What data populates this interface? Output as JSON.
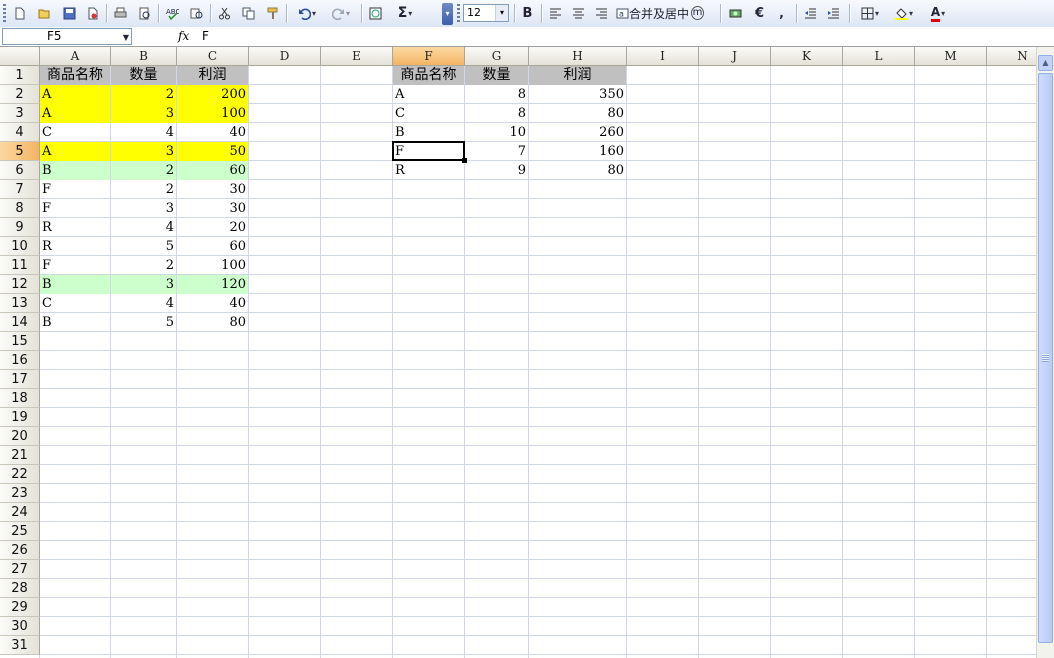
{
  "toolbar": {
    "font_size": "12",
    "merge_label": "合并及居中",
    "bold_label": "B",
    "sum_label": "Σ",
    "currency_label": "€",
    "comma_label": ",",
    "font_color_label": "A"
  },
  "formula_bar": {
    "name_box": "F5",
    "fx_label": "fx",
    "value": "F"
  },
  "sheet": {
    "columns": [
      "A",
      "B",
      "C",
      "D",
      "E",
      "F",
      "G",
      "H",
      "I",
      "J",
      "K",
      "L",
      "M",
      "N"
    ],
    "selected_column": "F",
    "rows": [
      "1",
      "2",
      "3",
      "4",
      "5",
      "6",
      "7",
      "8",
      "9",
      "10",
      "11",
      "12",
      "13",
      "14",
      "15",
      "16",
      "17",
      "18",
      "19",
      "20",
      "21",
      "22",
      "23",
      "24",
      "25",
      "26",
      "27",
      "28",
      "29",
      "30",
      "31"
    ],
    "selected_row": "5",
    "table1": {
      "headers": [
        "商品名称",
        "数量",
        "利润"
      ],
      "rows": [
        [
          "A",
          "2",
          "200"
        ],
        [
          "A",
          "3",
          "100"
        ],
        [
          "C",
          "4",
          "40"
        ],
        [
          "A",
          "3",
          "50"
        ],
        [
          "B",
          "2",
          "60"
        ],
        [
          "F",
          "2",
          "30"
        ],
        [
          "F",
          "3",
          "30"
        ],
        [
          "R",
          "4",
          "20"
        ],
        [
          "R",
          "5",
          "60"
        ],
        [
          "F",
          "2",
          "100"
        ],
        [
          "B",
          "3",
          "120"
        ],
        [
          "C",
          "4",
          "40"
        ],
        [
          "B",
          "5",
          "80"
        ]
      ],
      "row_colors": [
        "#ffff00",
        "#ffff00",
        "",
        "#ffff00",
        "#ccffcc",
        "",
        "",
        "",
        "",
        "",
        "#ccffcc",
        "",
        ""
      ],
      "header_color": "#c0c0c0"
    },
    "table2": {
      "headers": [
        "商品名称",
        "数量",
        "利润"
      ],
      "rows": [
        [
          "A",
          "8",
          "350"
        ],
        [
          "C",
          "8",
          "80"
        ],
        [
          "B",
          "10",
          "260"
        ],
        [
          "F",
          "7",
          "160"
        ],
        [
          "R",
          "9",
          "80"
        ]
      ],
      "header_color": "#c0c0c0"
    },
    "active_cell": "F5"
  }
}
